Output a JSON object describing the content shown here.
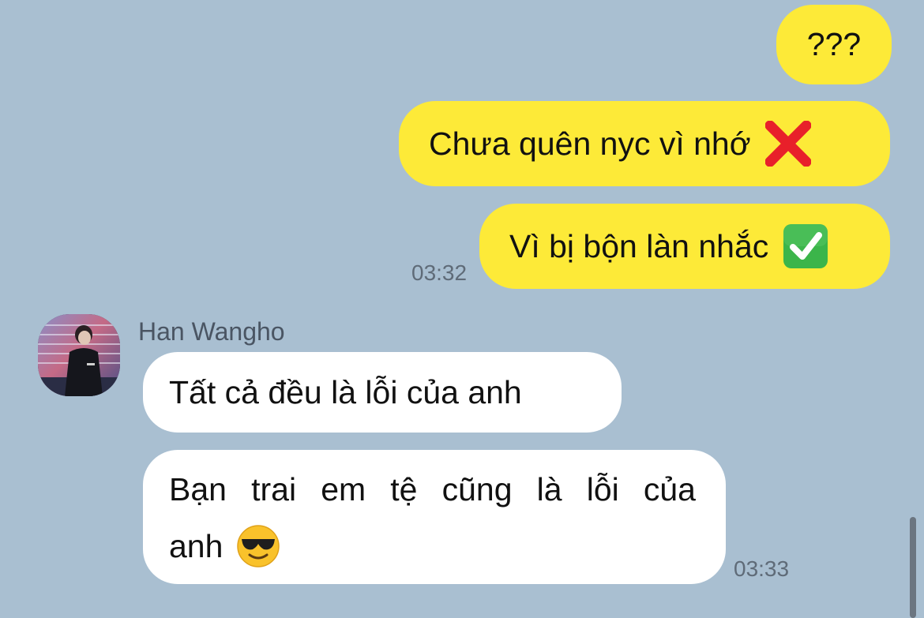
{
  "chat": {
    "outgoing": [
      {
        "text": "???"
      },
      {
        "text": "Chưa quên nyc vì nhớ",
        "emoji": "cross-mark-icon"
      },
      {
        "text": "Vì bị bộn làn nhắc",
        "emoji": "check-mark-button-icon",
        "time": "03:32"
      }
    ],
    "contact": {
      "name": "Han Wangho"
    },
    "incoming": [
      {
        "text": "Tất cả đều là lỗi của anh"
      },
      {
        "line1": "Bạn trai em tệ cũng là lỗi của",
        "line2": "anh",
        "emoji": "smiling-face-with-sunglasses-icon",
        "time": "03:33"
      }
    ]
  },
  "colors": {
    "background": "#a9bfd1",
    "outgoing_bubble": "#fdea38",
    "incoming_bubble": "#ffffff"
  }
}
